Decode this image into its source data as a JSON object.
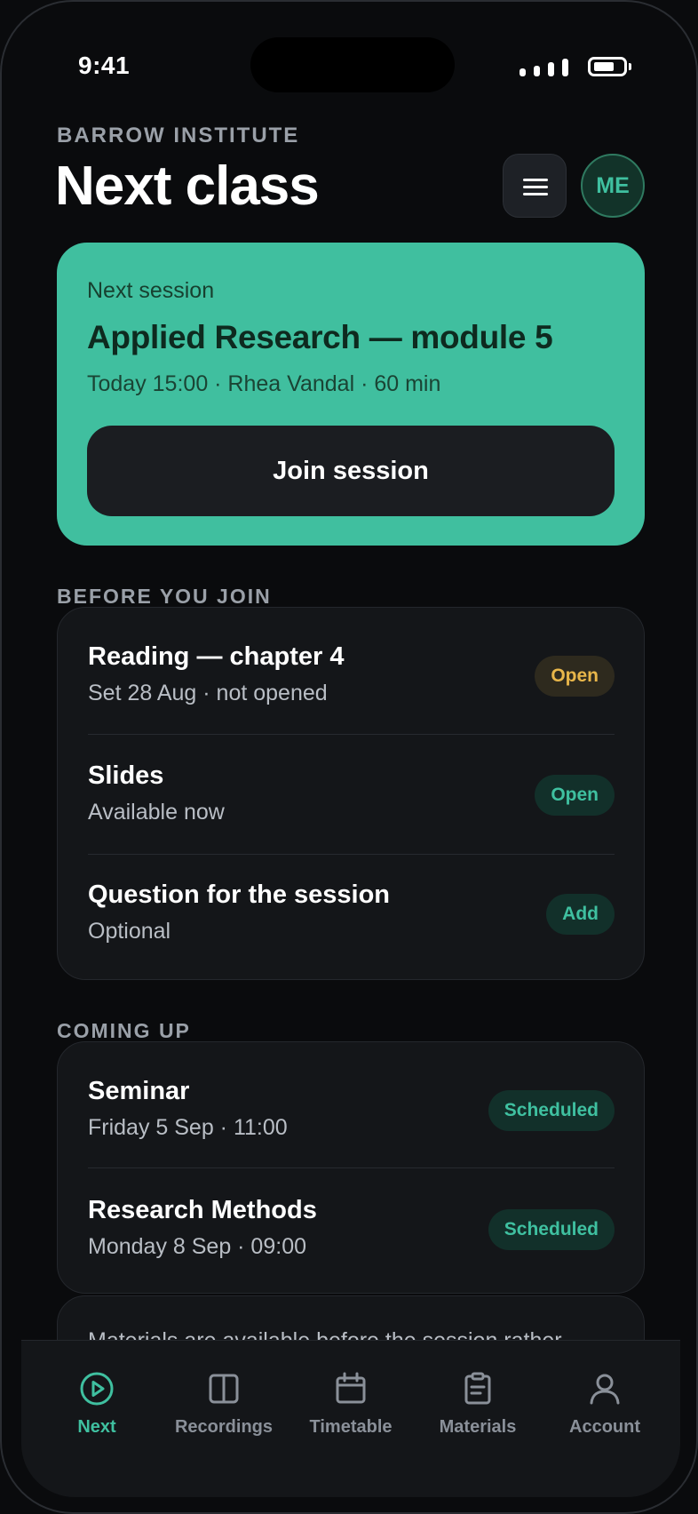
{
  "status_bar": {
    "time": "9:41"
  },
  "header": {
    "eyebrow": "BARROW INSTITUTE",
    "title": "Next class",
    "avatar_initials": "ME"
  },
  "next_session": {
    "eyebrow": "Next session",
    "title": "Applied Research — module 5",
    "meta": "Today 15:00 · Rhea Vandal · 60 min",
    "join_label": "Join session"
  },
  "before_you_join": {
    "label": "BEFORE YOU JOIN",
    "items": [
      {
        "title": "Reading — chapter 4",
        "subtitle": "Set 28 Aug · not opened",
        "action": "Open"
      },
      {
        "title": "Slides",
        "subtitle": "Available now",
        "action": "Open"
      },
      {
        "title": "Question for the session",
        "subtitle": "Optional",
        "action": "Add"
      }
    ]
  },
  "coming_up": {
    "label": "COMING UP",
    "items": [
      {
        "title": "Seminar",
        "subtitle": "Friday 5 Sep · 11:00",
        "status": "Scheduled"
      },
      {
        "title": "Research Methods",
        "subtitle": "Monday 8 Sep · 09:00",
        "status": "Scheduled"
      }
    ]
  },
  "note": {
    "text": "Materials are available before the session rather"
  },
  "tabbar": {
    "items": [
      {
        "label": "Next",
        "icon": "play-circle-icon",
        "active": true
      },
      {
        "label": "Recordings",
        "icon": "columns-icon"
      },
      {
        "label": "Timetable",
        "icon": "calendar-icon"
      },
      {
        "label": "Materials",
        "icon": "clipboard-icon"
      },
      {
        "label": "Account",
        "icon": "person-icon"
      }
    ]
  },
  "colors": {
    "accent": "#40bf9f",
    "accent_text": "#3fc0a0",
    "warning": "#e8b64a",
    "background": "#0a0b0d",
    "card": "#141619"
  }
}
